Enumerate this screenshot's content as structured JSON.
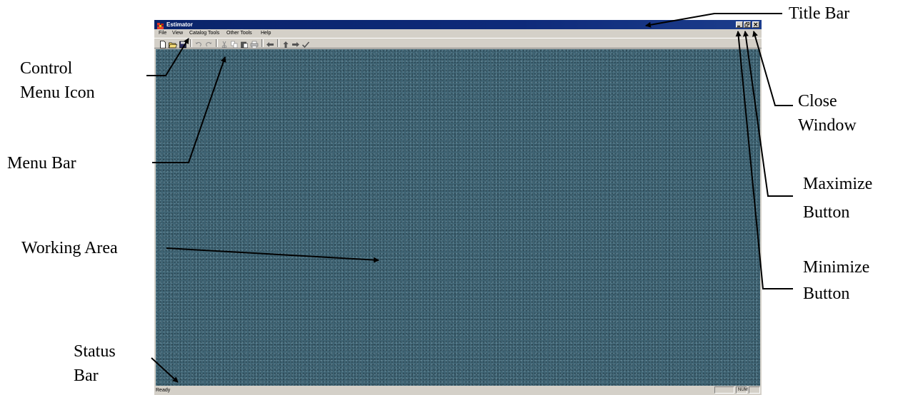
{
  "window": {
    "title": "Estimator",
    "menu": [
      "File",
      "View",
      "Catalog Tools",
      "Other Tools",
      "Help"
    ],
    "toolbar_icons": [
      "new-file-icon",
      "open-folder-icon",
      "save-icon",
      "undo-icon",
      "redo-icon",
      "cut-icon",
      "copy-icon",
      "paste-icon",
      "print-icon",
      "back-arrow-icon",
      "up-arrow-icon",
      "forward-arrow-icon",
      "checkmark-icon"
    ],
    "status": {
      "text": "Ready",
      "num_indicator": "NUM"
    },
    "colors": {
      "titlebar": "#0a246a",
      "chrome": "#d4d0c8",
      "workarea": "#3f6474"
    }
  },
  "annotations": {
    "title_bar": "Title Bar",
    "control_menu_icon": [
      "Control",
      "Menu Icon"
    ],
    "menu_bar": "Menu Bar",
    "working_area": "Working Area",
    "status_bar": [
      "Status",
      "Bar"
    ],
    "close_window": [
      "Close",
      "Window"
    ],
    "maximize_button": [
      "Maximize",
      "Button"
    ],
    "minimize_button": [
      "Minimize",
      "Button"
    ]
  }
}
